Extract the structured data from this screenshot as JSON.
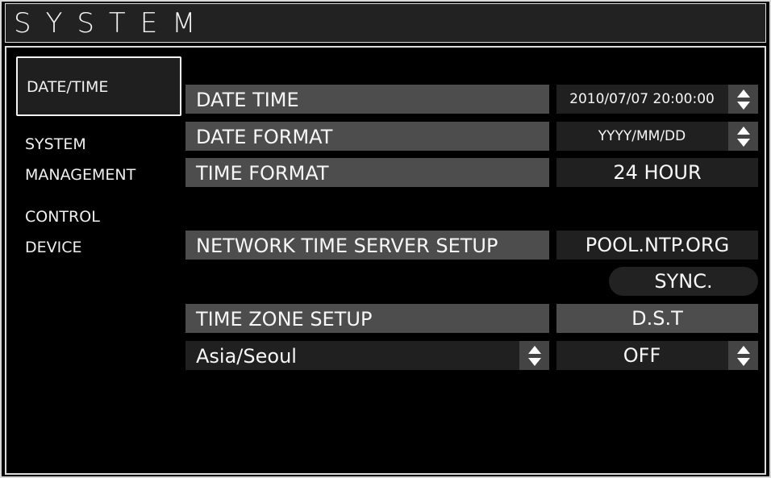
{
  "window": {
    "title": "SYSTEM"
  },
  "sidebar": {
    "items": [
      {
        "label": "DATE/TIME",
        "selected": true
      },
      {
        "label_line1": "SYSTEM",
        "label_line2": "MANAGEMENT",
        "selected": false
      },
      {
        "label_line1": "CONTROL",
        "label_line2": "DEVICE",
        "selected": false
      }
    ]
  },
  "settings": {
    "date_time": {
      "label": "DATE TIME",
      "value": "2010/07/07 20:00:00"
    },
    "date_format": {
      "label": "DATE FORMAT",
      "value": "YYYY/MM/DD"
    },
    "time_format": {
      "label": "TIME FORMAT",
      "value": "24 HOUR"
    },
    "ntp": {
      "label": "NETWORK TIME SERVER SETUP",
      "value": "POOL.NTP.ORG",
      "sync_label": "SYNC."
    },
    "time_zone": {
      "label": "TIME ZONE SETUP",
      "value": "Asia/Seoul"
    },
    "dst": {
      "label": "D.S.T",
      "value": "OFF"
    }
  },
  "colors": {
    "background": "#000000",
    "label_bg": "#4d4d4d",
    "value_bg": "#202020",
    "spinner_bg": "#444444",
    "text": "#f7f7f7",
    "border": "#dddddd"
  }
}
